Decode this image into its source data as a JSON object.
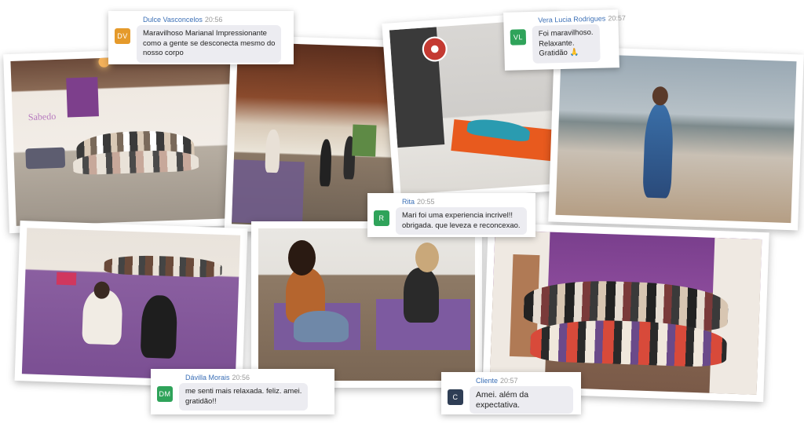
{
  "photos": [
    {
      "name": "group-photo-studio",
      "alt": "Group of women sitting in a yoga studio"
    },
    {
      "name": "class-photo-wooden-hall",
      "alt": "Dance class in a wooden hall"
    },
    {
      "name": "photo-lying-on-mat",
      "alt": "Woman lying on an orange mat"
    },
    {
      "name": "photo-beach-dance",
      "alt": "Woman dancing on the beach"
    },
    {
      "name": "photo-circle-purple-floor",
      "alt": "Women sitting in a circle on a purple floor"
    },
    {
      "name": "photo-two-women-mats",
      "alt": "Two women sitting on purple mats"
    },
    {
      "name": "photo-group-arms-raised",
      "alt": "Group raising arms in celebration"
    }
  ],
  "testimonials": [
    {
      "name": "Dulce Vasconcelos",
      "time": "20:56",
      "initials": "DV",
      "color": "#e59a2b",
      "message": "Maravilhoso Marianal Impressionante\ncomo a gente se desconecta mesmo do\nnosso corpo"
    },
    {
      "name": "Vera Lucia Rodrigues",
      "time": "20:57",
      "initials": "VL",
      "color": "#2fa35a",
      "message": "Foi maravilhoso.\nRelaxante.\nGratidão 🙏"
    },
    {
      "name": "Rita",
      "time": "20:55",
      "initials": "R",
      "color": "#2fa35a",
      "message": "Mari foi uma experiencia incrivel!!\nobrigada. que leveza e reconcexao."
    },
    {
      "name": "Dávilla Morais",
      "time": "20:56",
      "initials": "DM",
      "color": "#2fa35a",
      "message": "me senti mais relaxada. feliz. amei.\ngratidão!!"
    },
    {
      "name": "Cliente",
      "time": "20:57",
      "initials": "C",
      "color": "#2f3e55",
      "message": "Amei. além da expectativa."
    }
  ]
}
